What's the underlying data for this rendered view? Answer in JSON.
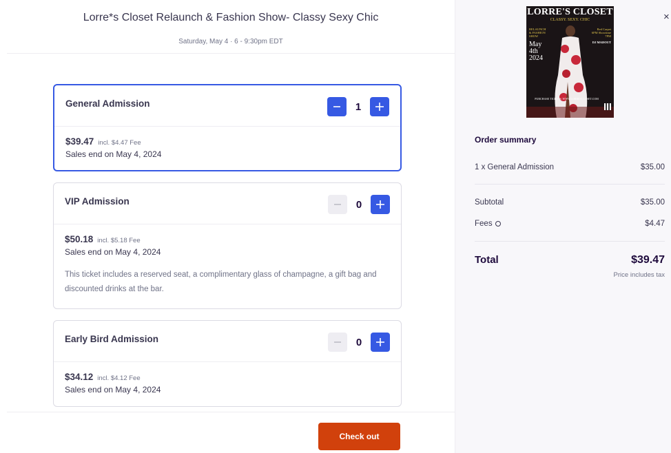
{
  "event": {
    "title": "Lorre*s Closet Relaunch & Fashion Show- Classy Sexy Chic",
    "datetime": "Saturday, May 4 · 6 - 9:30pm EDT"
  },
  "tickets": [
    {
      "name": "General Admission",
      "quantity": "1",
      "price": "$39.47",
      "fee": "incl. $4.47 Fee",
      "sales_end": "Sales end on May 4, 2024",
      "description": ""
    },
    {
      "name": "VIP Admission",
      "quantity": "0",
      "price": "$50.18",
      "fee": "incl. $5.18 Fee",
      "sales_end": "Sales end on May 4, 2024",
      "description": "This ticket includes a reserved seat, a complimentary glass of champagne, a gift bag and discounted drinks at the bar."
    },
    {
      "name": "Early Bird Admission",
      "quantity": "0",
      "price": "$34.12",
      "fee": "incl. $4.12 Fee",
      "sales_end": "Sales end on May 4, 2024",
      "description": ""
    }
  ],
  "footer": {
    "checkout_label": "Check out"
  },
  "poster": {
    "title": "LORRE'S CLOSET",
    "subtitle": "CLASSY. SEXY. CHIC",
    "left_text": "RELAUNCH & FASHION SHOW",
    "date_month": "May",
    "date_day": "4th",
    "date_year": "2024",
    "right_text": "Red Carpet 6PM Showtime 7PM",
    "dj": "DJ MADOUT",
    "url": "PURCHASE TICKETS: WWW.LORRESCLOSET.COM"
  },
  "close_symbol": "×",
  "summary": {
    "title": "Order summary",
    "line_label": "1 x General Admission",
    "line_amount": "$35.00",
    "subtotal_label": "Subtotal",
    "subtotal_amount": "$35.00",
    "fees_label": "Fees",
    "fees_amount": "$4.47",
    "total_label": "Total",
    "total_amount": "$39.47",
    "tax_note": "Price includes tax"
  },
  "colors": {
    "accent": "#3659e3",
    "checkout": "#d1410c",
    "text_dark": "#1e0a3c"
  }
}
